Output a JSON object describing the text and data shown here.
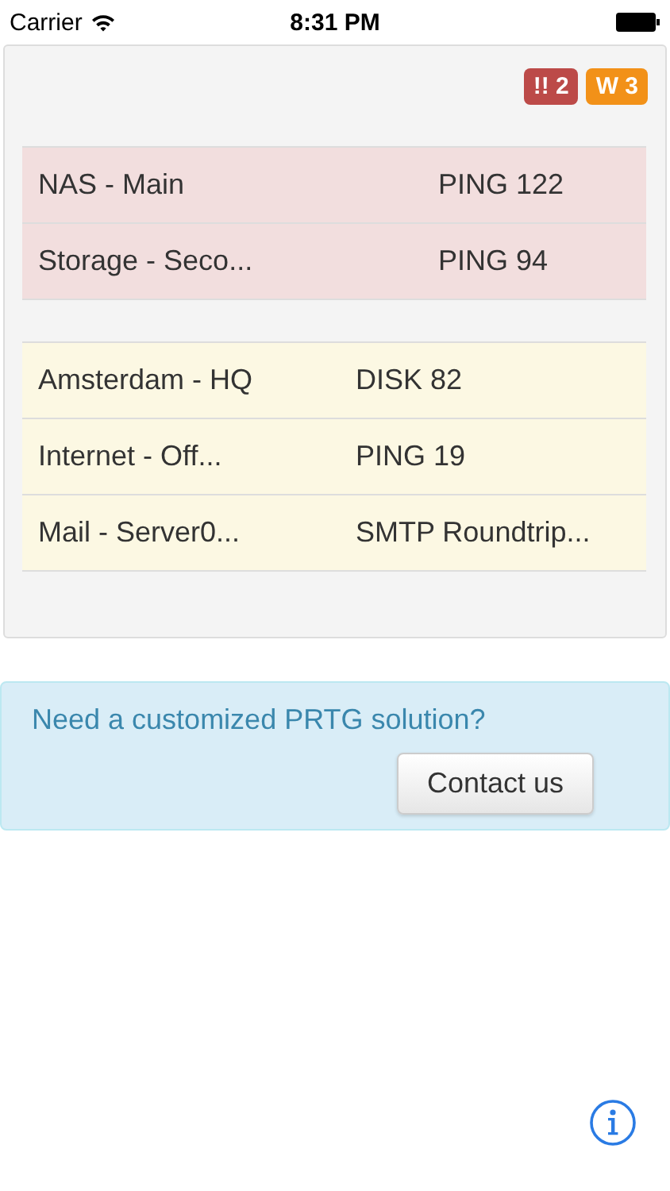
{
  "status_bar": {
    "carrier": "Carrier",
    "time": "8:31 PM"
  },
  "badges": [
    {
      "kind": "error",
      "label": "!! 2"
    },
    {
      "kind": "warning",
      "label": "W 3"
    }
  ],
  "groups": [
    {
      "kind": "down",
      "rows": [
        {
          "device": "NAS - Main",
          "sensor": "PING 122"
        },
        {
          "device": "Storage - Seco...",
          "sensor": "PING 94"
        }
      ]
    },
    {
      "kind": "warning",
      "rows": [
        {
          "device": "Amsterdam - HQ",
          "sensor": "DISK 82"
        },
        {
          "device": "Internet - Off...",
          "sensor": "PING 19"
        },
        {
          "device": "Mail - Server0...",
          "sensor": "SMTP Roundtrip..."
        }
      ]
    }
  ],
  "promo": {
    "text": "Need a customized PRTG solution?",
    "button": "Contact us"
  }
}
